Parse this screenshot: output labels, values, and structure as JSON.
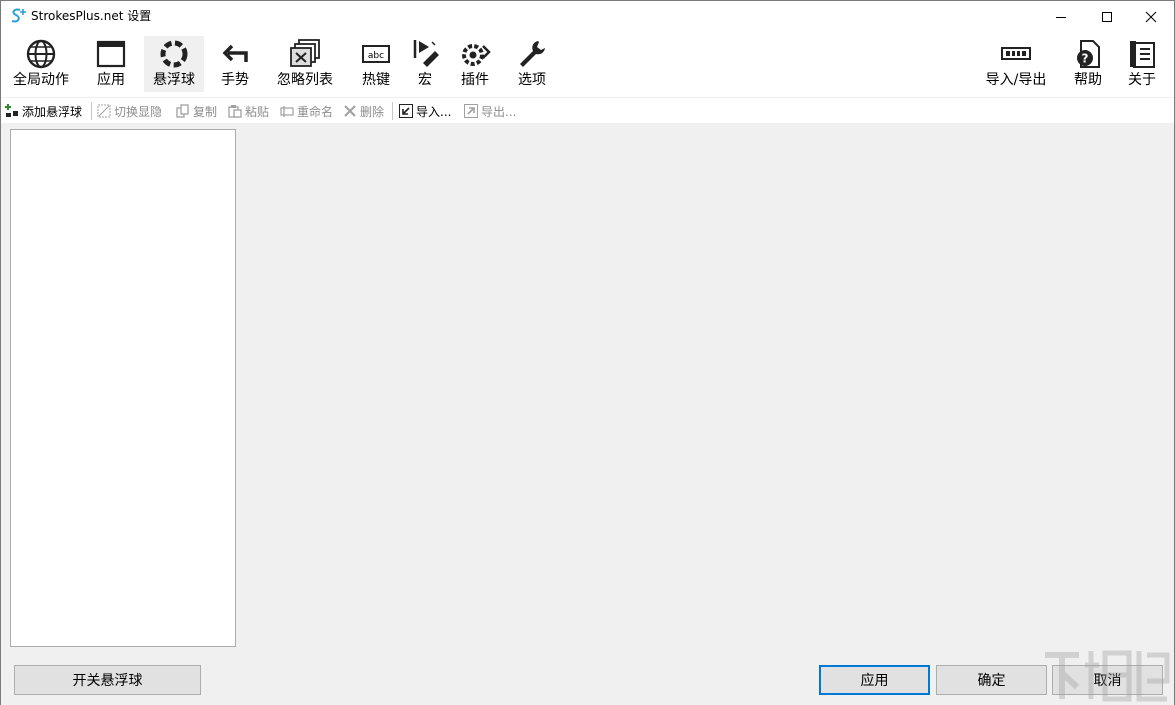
{
  "window": {
    "title": "StrokesPlus.net 设置"
  },
  "toolbar": {
    "items": [
      {
        "label": "全局动作",
        "icon": "globe-icon"
      },
      {
        "label": "应用",
        "icon": "window-icon"
      },
      {
        "label": "悬浮球",
        "icon": "ring-icon",
        "active": true
      },
      {
        "label": "手势",
        "icon": "gesture-arrow-icon"
      },
      {
        "label": "忽略列表",
        "icon": "ignore-list-icon"
      },
      {
        "label": "热键",
        "icon": "keyboard-abc-icon"
      },
      {
        "label": "宏",
        "icon": "macro-icon"
      },
      {
        "label": "插件",
        "icon": "plugin-gear-icon"
      },
      {
        "label": "选项",
        "icon": "wrench-icon"
      }
    ],
    "right_items": [
      {
        "label": "导入/导出",
        "icon": "import-export-icon"
      },
      {
        "label": "帮助",
        "icon": "help-icon"
      },
      {
        "label": "关于",
        "icon": "about-icon"
      }
    ]
  },
  "subtoolbar": {
    "add": "添加悬浮球",
    "toggle": "切换显隐",
    "copy": "复制",
    "paste": "粘贴",
    "rename": "重命名",
    "delete": "删除",
    "import": "导入...",
    "export": "导出..."
  },
  "footer": {
    "toggle_button": "开关悬浮球",
    "apply_button": "应用",
    "ok_button": "确定",
    "cancel_button": "取消"
  },
  "colors": {
    "accent": "#0078d7",
    "panel": "#f0f0f0"
  }
}
